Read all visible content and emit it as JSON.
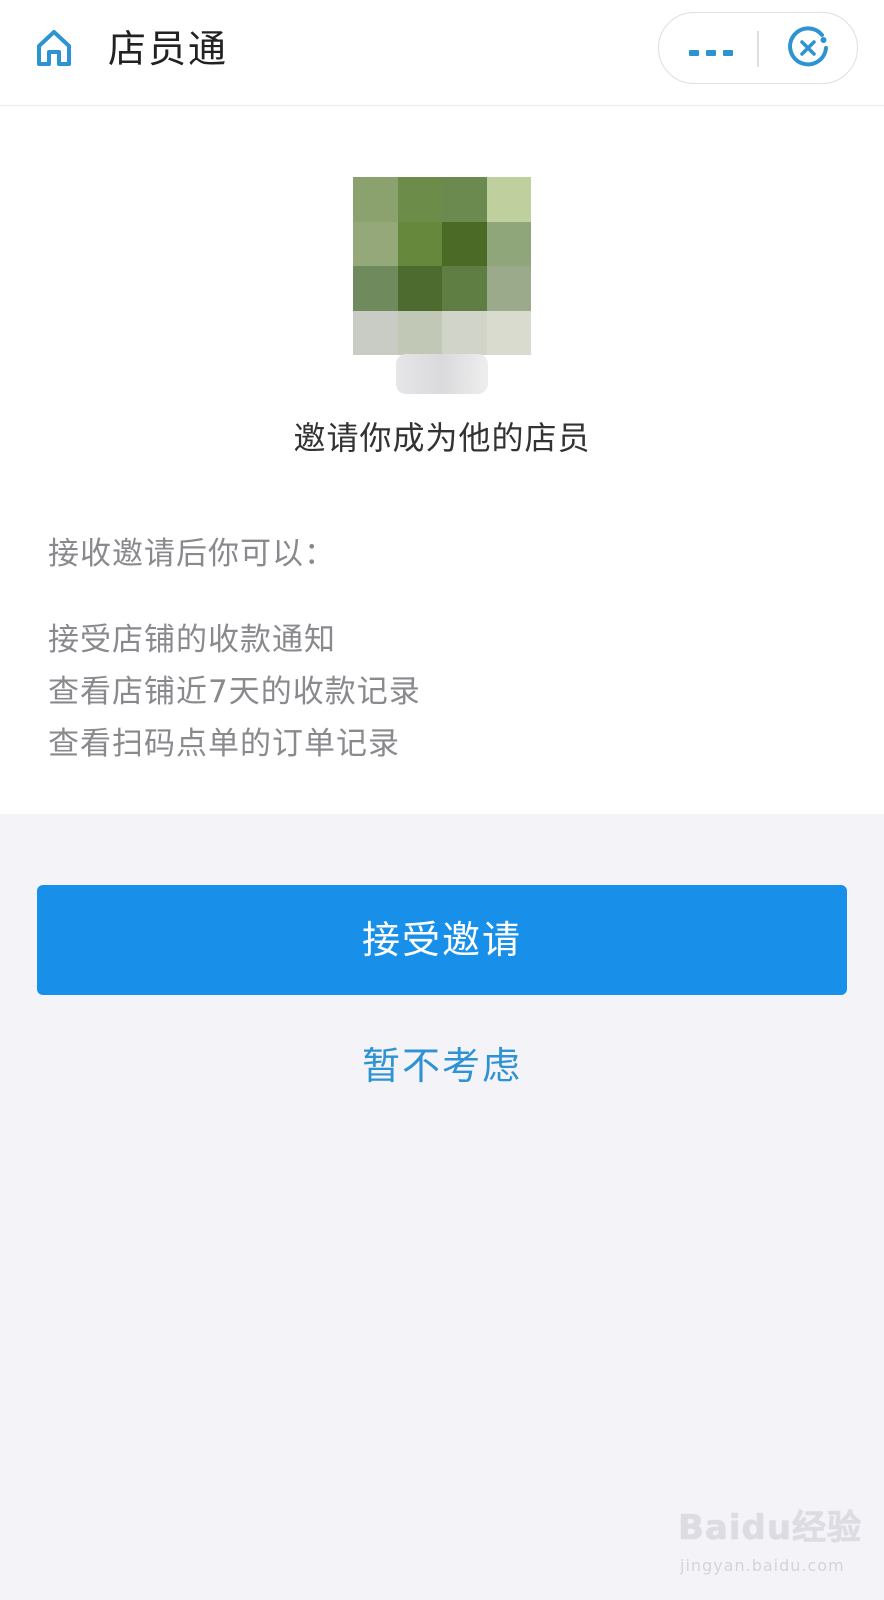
{
  "header": {
    "title": "店员通",
    "icons": {
      "home": "home-icon",
      "more": "more-icon",
      "close": "close-icon"
    },
    "accent_color": "#2d93d3"
  },
  "invite": {
    "message": "邀请你成为他的店员",
    "benefits_heading": "接收邀请后你可以：",
    "benefits": [
      "接受店铺的收款通知",
      "查看店铺近7天的收款记录",
      "查看扫码点单的订单记录"
    ]
  },
  "actions": {
    "accept_label": "接受邀请",
    "accept_color": "#1890ea",
    "decline_label": "暂不考虑"
  },
  "watermark": {
    "logo": "Baidu经验",
    "url": "jingyan.baidu.com"
  }
}
